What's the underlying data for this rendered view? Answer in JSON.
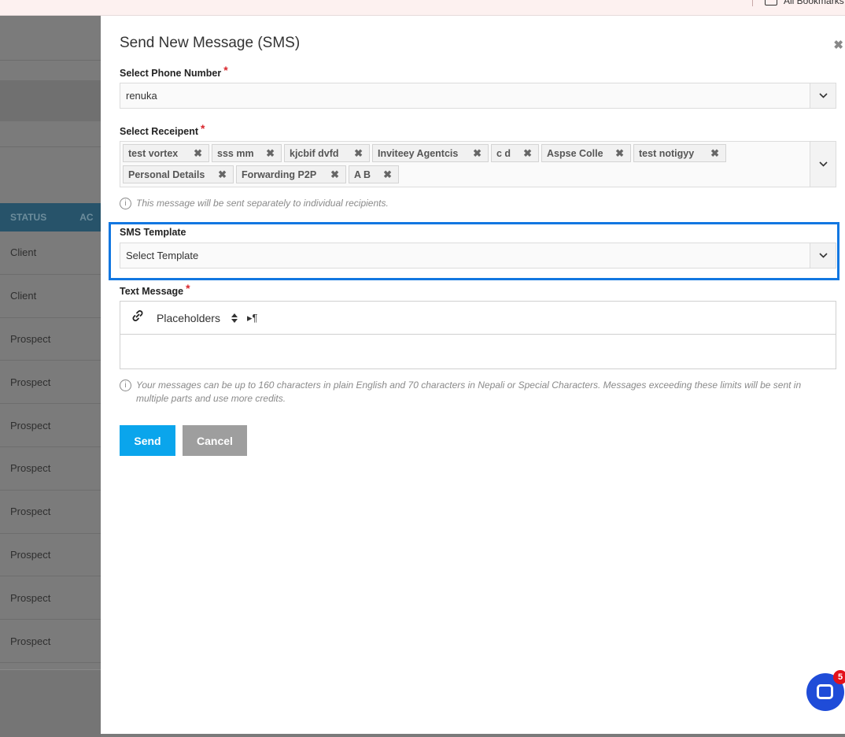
{
  "browser": {
    "bookmarks_label": "All Bookmarks"
  },
  "background": {
    "columns": [
      "STATUS",
      "AC"
    ],
    "rows": [
      "Client",
      "Client",
      "Prospect",
      "Prospect",
      "Prospect",
      "Prospect",
      "Prospect",
      "Prospect",
      "Prospect",
      "Prospect"
    ]
  },
  "modal": {
    "title": "Send New Message (SMS)",
    "close_icon": "✖",
    "phone": {
      "label": "Select Phone Number",
      "required": "*",
      "value": "renuka"
    },
    "recipient": {
      "label": "Select Receipent",
      "required": "*",
      "tags": [
        "test vortex",
        "sss mm",
        "kjcbif dvfd",
        "Inviteey Agentcis",
        "c d",
        "Aspse Colle",
        "test notigyy",
        "Personal Details",
        "Forwarding P2P",
        "A B"
      ],
      "remove_icon": "✖",
      "note": "This message will be sent separately to individual recipients."
    },
    "template": {
      "label": "SMS Template",
      "value": "Select Template"
    },
    "text_message": {
      "label": "Text Message",
      "required": "*",
      "placeholders_label": "Placeholders",
      "note": "Your messages can be up to 160 characters in plain English and 70 characters in Nepali or Special Characters. Messages exceeding these limits will be sent in multiple parts and use more credits."
    },
    "buttons": {
      "send": "Send",
      "cancel": "Cancel"
    }
  },
  "chat": {
    "badge_count": "5"
  },
  "icons": {
    "chevron": "chevron-down-icon",
    "link": "link-icon",
    "info": "info-icon",
    "close": "close-icon",
    "chat": "chat-icon"
  },
  "colors": {
    "accent": "#0aa5ec",
    "focus_border": "#1277e1",
    "required": "#d9262c",
    "chat": "#1f4cd8"
  }
}
